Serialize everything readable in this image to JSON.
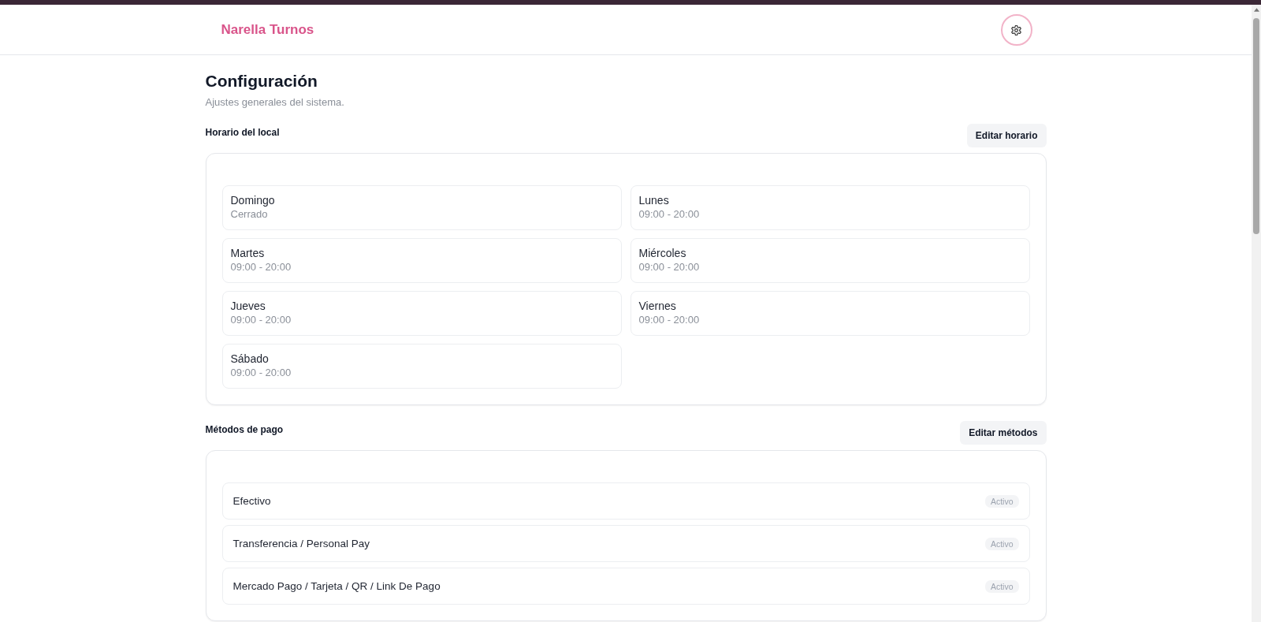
{
  "header": {
    "brand": "Narella Turnos"
  },
  "page": {
    "title": "Configuración",
    "subtitle": "Ajustes generales del sistema."
  },
  "sections": [
    {
      "kind": "schedule",
      "title": "Horario del local",
      "edit_button": "Editar horario",
      "days": [
        {
          "name": "Domingo",
          "hours": "Cerrado"
        },
        {
          "name": "Lunes",
          "hours": "09:00 - 20:00"
        },
        {
          "name": "Martes",
          "hours": "09:00 - 20:00"
        },
        {
          "name": "Miércoles",
          "hours": "09:00 - 20:00"
        },
        {
          "name": "Jueves",
          "hours": "09:00 - 20:00"
        },
        {
          "name": "Viernes",
          "hours": "09:00 - 20:00"
        },
        {
          "name": "Sábado",
          "hours": "09:00 - 20:00"
        }
      ]
    },
    {
      "kind": "payment_methods",
      "title": "Métodos de pago",
      "edit_button": "Editar métodos",
      "methods": [
        {
          "name": "Efectivo",
          "status": "Activo"
        },
        {
          "name": "Transferencia / Personal Pay",
          "status": "Activo"
        },
        {
          "name": "Mercado Pago / Tarjeta / QR / Link De Pago",
          "status": "Activo"
        }
      ]
    }
  ]
}
